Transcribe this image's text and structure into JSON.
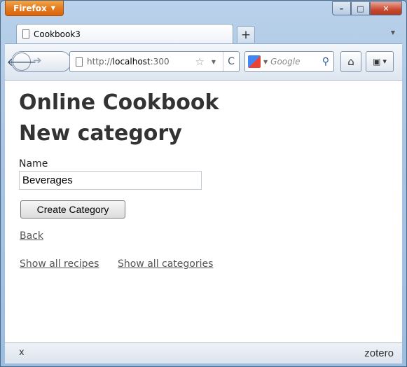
{
  "browser": {
    "app_button": "Firefox",
    "tab_title": "Cookbook3",
    "new_tab": "+",
    "url_prefix": "http://",
    "url_host": "localhost",
    "url_rest": ":300",
    "search_placeholder": "Google",
    "status_close": "x",
    "status_addon": "zotero"
  },
  "page": {
    "site_title": "Online Cookbook",
    "heading": "New category",
    "name_label": "Name",
    "name_value": "Beverages",
    "submit_label": "Create Category",
    "back_link": "Back",
    "recipes_link": "Show all recipes",
    "categories_link": "Show all categories"
  }
}
